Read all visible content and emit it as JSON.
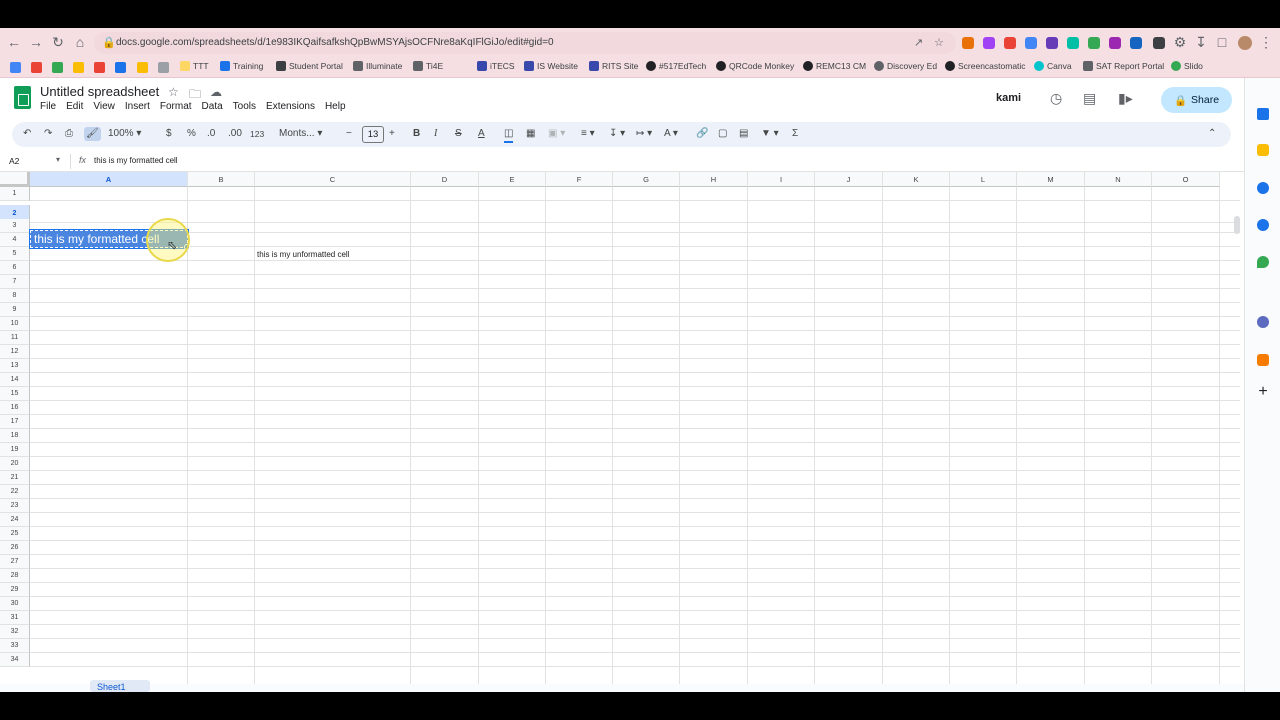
{
  "browser": {
    "url": "docs.google.com/spreadsheets/d/1e983IKQaifsafkshQpBwMSYAjsOCFNre8aKqIFlGiJo/edit#gid=0",
    "bookmarks": [
      "TTT",
      "Training",
      "Student Portal",
      "Illuminate",
      "Ti4E",
      "iTECS",
      "IS Website",
      "RITS Site",
      "#517EdTech",
      "QRCode Monkey",
      "REMC13 CM",
      "Discovery Ed",
      "Screencastomatic",
      "Canva",
      "SAT Report Portal",
      "Slido"
    ]
  },
  "app": {
    "title": "Untitled spreadsheet",
    "menu": [
      "File",
      "Edit",
      "View",
      "Insert",
      "Format",
      "Data",
      "Tools",
      "Extensions",
      "Help"
    ],
    "kami_label": "kami",
    "share_label": "Share"
  },
  "toolbar": {
    "zoom": "100%",
    "currency": "$",
    "percent": "%",
    "dec_decrease": ".0",
    "dec_increase": ".00",
    "number_format": "123",
    "font": "Monts...",
    "font_size": "13",
    "bold": "B",
    "italic": "I",
    "strike": "S",
    "text_color": "A"
  },
  "formula_bar": {
    "cell_ref": "A2",
    "fx": "fx",
    "value": "this is my formatted cell"
  },
  "grid": {
    "columns": [
      "A",
      "B",
      "C",
      "D",
      "E",
      "F",
      "G",
      "H",
      "I",
      "J",
      "K",
      "L",
      "M",
      "N",
      "O"
    ],
    "rows": [
      "1",
      "2",
      "3",
      "4",
      "5",
      "6",
      "7",
      "8",
      "9",
      "10",
      "11",
      "12",
      "13",
      "14",
      "15",
      "16",
      "17",
      "18",
      "19",
      "20",
      "21",
      "22",
      "23",
      "24",
      "25",
      "26",
      "27",
      "28",
      "29",
      "30",
      "31",
      "32",
      "33",
      "34"
    ],
    "selected_column": "A",
    "selected_row": "2",
    "cells": {
      "A2": "this is my formatted cell",
      "C3": "this is my unformatted cell"
    }
  },
  "sheet_tab": "Sheet1",
  "colors": {
    "selection_fill": "#4a86e0",
    "accent": "#1a73e8",
    "share_bg": "#c2e7ff",
    "chrome_bg": "#f5dfe3"
  }
}
